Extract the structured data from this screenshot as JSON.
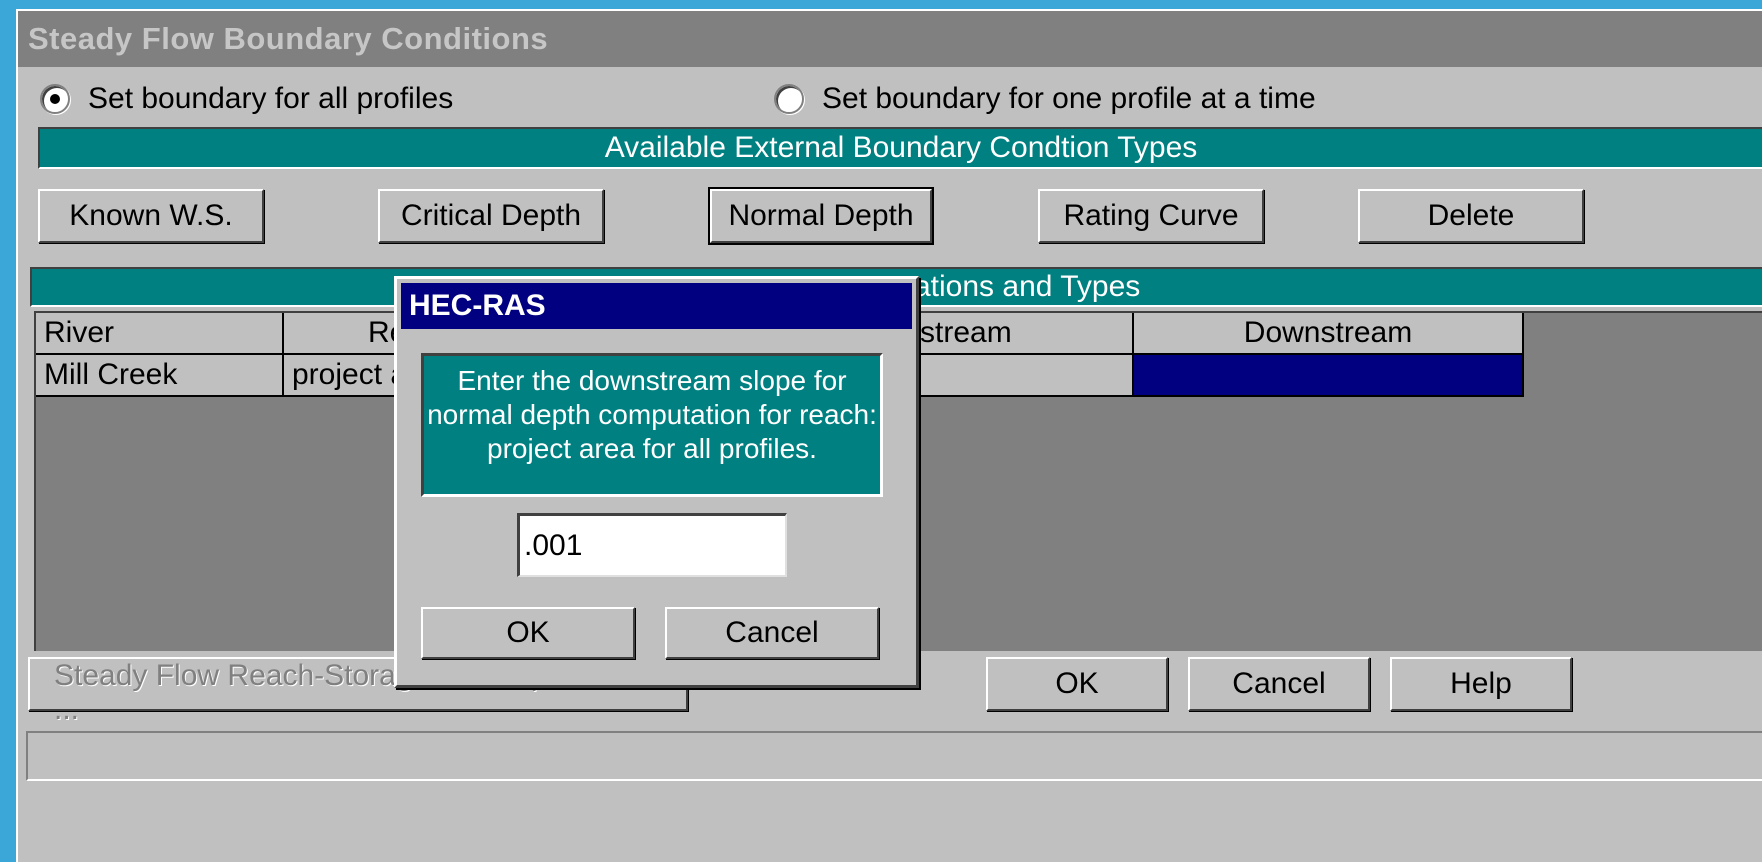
{
  "window": {
    "title": "Steady Flow Boundary Conditions"
  },
  "mode": {
    "all_profiles_label": "Set boundary for all profiles",
    "one_profile_label": "Set boundary for one profile at a time",
    "selected": "all_profiles"
  },
  "types_header": "Available External Boundary Condtion Types",
  "type_buttons": {
    "known_ws": "Known W.S.",
    "critical_depth": "Critical Depth",
    "normal_depth": "Normal Depth",
    "rating_curve": "Rating Curve",
    "delete": "Delete"
  },
  "locations_header": "ations and Types",
  "table": {
    "columns": [
      "River",
      "Re",
      "stream",
      "Downstream"
    ],
    "rows": [
      {
        "river": "Mill Creek",
        "reach": "project a",
        "upstream": "",
        "downstream": ""
      }
    ]
  },
  "bottom_buttons": {
    "optimization": "Steady Flow Reach-Storage Area Optimization ...",
    "ok": "OK",
    "cancel": "Cancel",
    "help": "Help"
  },
  "dialog": {
    "title": "HEC-RAS",
    "message": "Enter the downstream slope for\nnormal depth computation for reach:\n  project area   for all profiles.",
    "input_value": ".001",
    "ok": "OK",
    "cancel": "Cancel"
  },
  "colors": {
    "teal": "#008080",
    "navy": "#000080",
    "face": "#c0c0c0",
    "titlebar": "#808080"
  }
}
